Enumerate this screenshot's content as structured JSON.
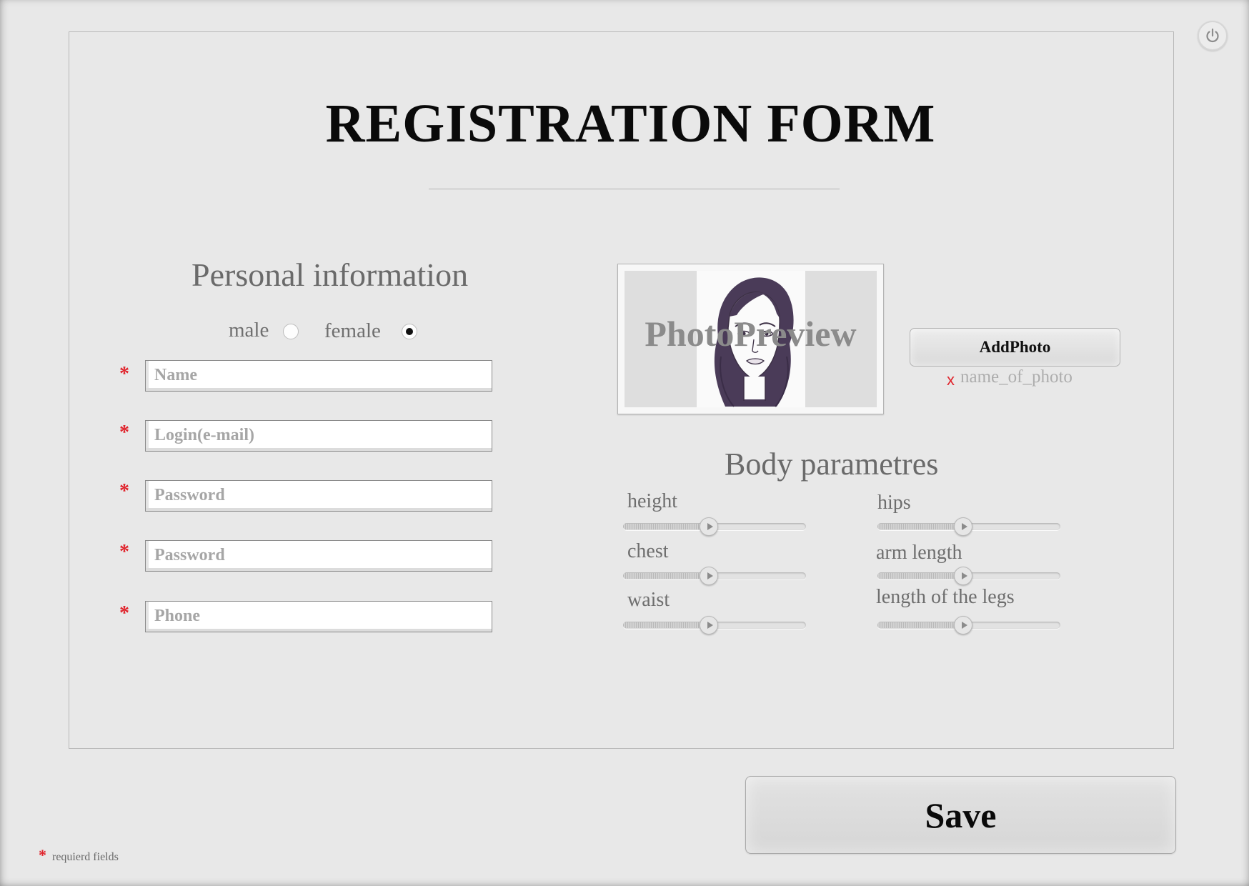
{
  "form": {
    "title": "REGISTRATION FORM",
    "save_label": "Save",
    "required_star": "*",
    "required_note": "requierd fields"
  },
  "personal": {
    "title": "Personal information",
    "gender": {
      "male_label": "male",
      "female_label": "female",
      "selected": "female"
    },
    "fields": [
      {
        "placeholder": "Name",
        "value": "",
        "required": true
      },
      {
        "placeholder": "Login(e-mail)",
        "value": "",
        "required": true
      },
      {
        "placeholder": "Password",
        "value": "",
        "required": true
      },
      {
        "placeholder": "Password",
        "value": "",
        "required": true
      },
      {
        "placeholder": "Phone",
        "value": "",
        "required": true
      }
    ]
  },
  "photo": {
    "preview_label": "PhotoPreview",
    "add_button_label": "AddPhoto",
    "remove_mark": "x",
    "file_name": "name_of_photo"
  },
  "body": {
    "title": "Body parametres",
    "params": [
      {
        "label": "height",
        "value_fraction": 0.47
      },
      {
        "label": "hips",
        "value_fraction": 0.47
      },
      {
        "label": "chest",
        "value_fraction": 0.47
      },
      {
        "label": "arm length",
        "value_fraction": 0.47
      },
      {
        "label": "waist",
        "value_fraction": 0.47
      },
      {
        "label": "length of the legs",
        "value_fraction": 0.47
      }
    ]
  },
  "icons": {
    "power": "power-icon",
    "slider_thumb": "play-arrow-icon",
    "face": "face-illustration"
  },
  "colors": {
    "required": "#e0242c",
    "background": "#e8e8e8"
  }
}
